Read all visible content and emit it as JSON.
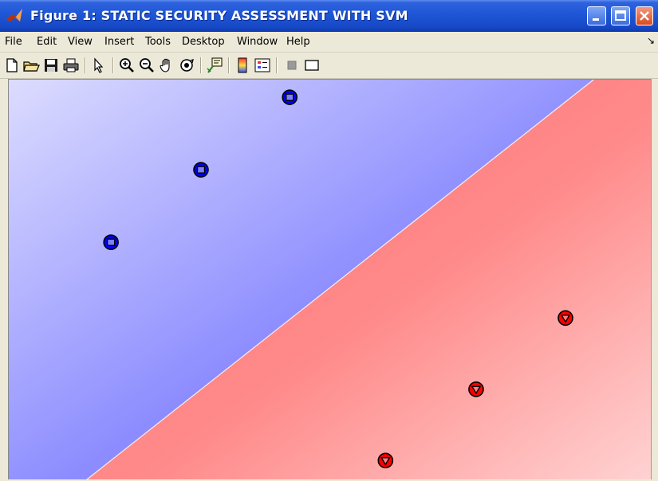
{
  "window": {
    "title": "Figure 1: STATIC SECURITY ASSESSMENT WITH SVM",
    "icon": "matlab-logo-icon",
    "controls": [
      "minimize-icon",
      "maximize-icon",
      "close-icon"
    ]
  },
  "menu": [
    "File",
    "Edit",
    "View",
    "Insert",
    "Tools",
    "Desktop",
    "Window",
    "Help"
  ],
  "toolbar": {
    "buttons": [
      {
        "name": "new-figure-button",
        "icon": "new-file-icon"
      },
      {
        "name": "open-file-button",
        "icon": "folder-open-icon"
      },
      {
        "name": "save-figure-button",
        "icon": "floppy-disk-icon"
      },
      {
        "name": "print-figure-button",
        "icon": "printer-icon"
      },
      {
        "name": "edit-plot-button",
        "icon": "arrow-pointer-icon"
      },
      {
        "name": "zoom-in-button",
        "icon": "zoom-in-icon"
      },
      {
        "name": "zoom-out-button",
        "icon": "zoom-out-icon"
      },
      {
        "name": "pan-button",
        "icon": "hand-icon"
      },
      {
        "name": "rotate-3d-button",
        "icon": "rotate-3d-icon"
      },
      {
        "name": "data-cursor-button",
        "icon": "data-cursor-icon"
      },
      {
        "name": "insert-colorbar-button",
        "icon": "colorbar-icon"
      },
      {
        "name": "insert-legend-button",
        "icon": "legend-icon"
      },
      {
        "name": "hide-plot-tools-button",
        "icon": "hide-tools-icon"
      },
      {
        "name": "show-plot-tools-button",
        "icon": "show-tools-icon"
      }
    ]
  },
  "chart_data": {
    "type": "scatter",
    "xlim": [
      0,
      1
    ],
    "ylim": [
      0,
      1
    ],
    "grid": false,
    "decision_boundary": {
      "x1": 0.12,
      "y1": 0.0,
      "x2": 0.89,
      "y2": 0.975
    },
    "regions": {
      "upper_left_color": "#8080ff",
      "lower_right_color": "#ff8080"
    },
    "series": [
      {
        "marker": "square-in-circle",
        "color": "#0000ff",
        "x": [
          0.437,
          0.299,
          0.159
        ],
        "y": [
          0.956,
          0.775,
          0.594
        ]
      },
      {
        "marker": "triangle-down-in-circle",
        "color": "#ff0000",
        "x": [
          0.866,
          0.727,
          0.586
        ],
        "y": [
          0.405,
          0.227,
          0.049
        ]
      }
    ]
  }
}
